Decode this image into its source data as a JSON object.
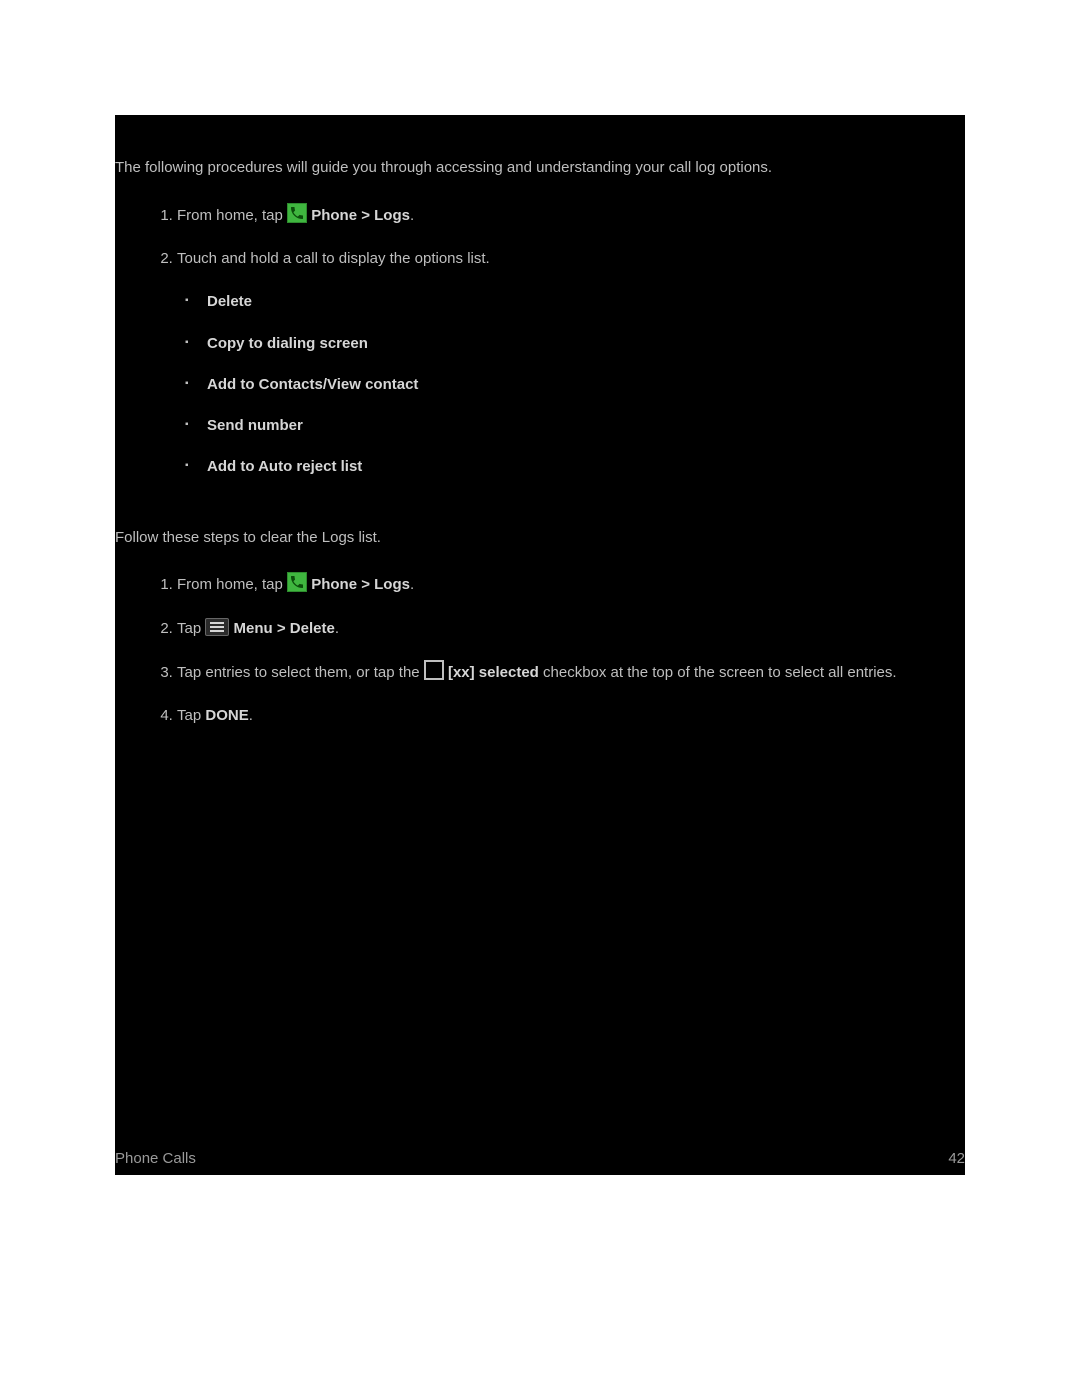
{
  "intro": "The following procedures will guide you through accessing and understanding your call log options.",
  "proc1": {
    "step1_a": "From home, tap ",
    "step1_b": " Phone > Logs",
    "step1_c": ".",
    "step2": "Touch and hold a call to display the options list.",
    "sub": {
      "a": "Delete",
      "b": "Copy to dialing screen",
      "c": "Add to Contacts/View contact",
      "d": "Send number",
      "e": "Add to Auto reject list"
    }
  },
  "intro2": "Follow these steps to clear the Logs list.",
  "proc2": {
    "step1_a": "From home, tap ",
    "step1_b": " Phone > Logs",
    "step1_c": ".",
    "step2_a": "Tap ",
    "step2_b": " Menu > Delete",
    "step2_c": ".",
    "step3_a": "Tap entries to select them, or tap the ",
    "step3_b": " [xx] selected",
    "step3_c": " checkbox at the top of the screen to select all entries.",
    "step4_a": "Tap ",
    "step4_b": "DONE",
    "step4_c": "."
  },
  "footer": {
    "left": "Phone Calls",
    "right": "42"
  }
}
